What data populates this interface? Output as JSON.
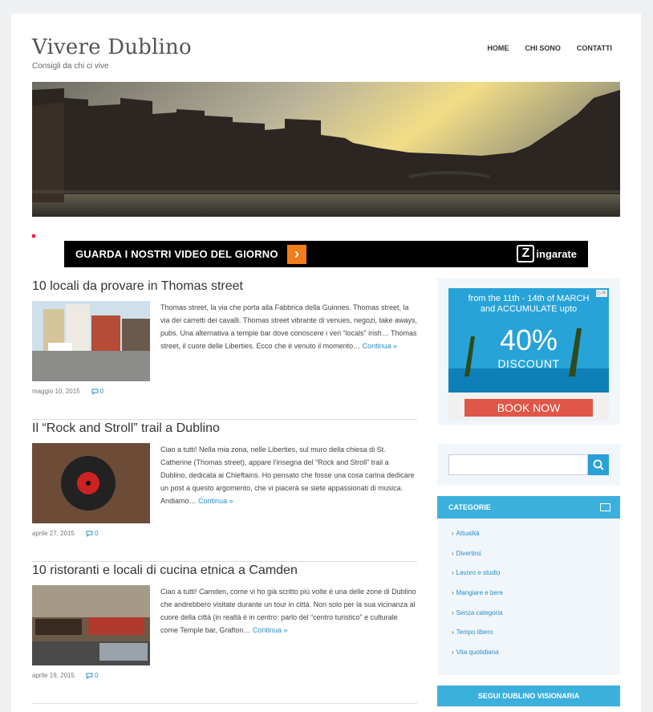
{
  "site": {
    "title": "Vivere Dublino",
    "description": "Consigli da chi ci vive"
  },
  "nav": {
    "items": [
      "HOME",
      "CHI SONO",
      "CONTATTI"
    ]
  },
  "banner": {
    "text": "GUARDA I NOSTRI VIDEO DEL GIORNO",
    "arrow": "›",
    "logo_letter": "Z",
    "logo_text": "ingarate"
  },
  "posts": [
    {
      "title": "10 locali da provare in Thomas street",
      "excerpt": "Thomas street, la via che porta alla Fabbrica della Guinnes. Thomas street, la via dei carretti dei cavalli. Thomas street vibrante di venues, negozi, take aways, pubs. Una alternativa a temple bar dove conoscere i veri “locals” irish… Thomas street, il cuore delle Liberties. Ecco che è venuto il momento…",
      "more": "Continua »",
      "date": "maggio 10, 2015",
      "comments": "0"
    },
    {
      "title": "Il “Rock and Stroll” trail a Dublino",
      "excerpt": "Ciao a tutti! Nella mia zona, nelle Liberties, sul muro della chiesa di St. Catherine (Thomas street), appare l’insegna del “Rock and Stroll” trail a Dublino, dedicata ai Chieftains. Ho pensato che fosse una cosa carina dedicare un post a questo argomento, che vi piacerà se siete appassionati di musica. Andiamo…",
      "more": "Continua »",
      "date": "aprile 27, 2015",
      "comments": "0"
    },
    {
      "title": "10 ristoranti e locali di cucina etnica a Camden",
      "excerpt": "Ciao a tutti! Camden, come vi ho già scritto più volte è una delle zone di Dublino che andrebbero visitate durante un tour in città. Non solo per la sua vicinanza al cuore della città (in realtà è in centro: parlo del “centro turistico” e culturale come Temple bar, Grafton…",
      "more": "Continua »",
      "date": "aprile 19, 2015",
      "comments": "0"
    }
  ],
  "ad": {
    "line1": "from the 11th - 14th of MARCH",
    "line2": "and ACCUMULATE upto",
    "percent": "40%",
    "discount": "DISCOUNT",
    "button": "BOOK NOW",
    "close": "▷✕"
  },
  "search": {
    "placeholder": ""
  },
  "categories": {
    "title": "CATEGORIE",
    "items": [
      "Attualità",
      "Divertirsi",
      "Lavoro e studio",
      "Mangiare e bere",
      "Senza categoria",
      "Tempo libero",
      "Vita quotidiana"
    ]
  },
  "follow": {
    "title": "SEGUI DUBLINO VISIONARIA"
  },
  "colors": {
    "accent": "#3bb0dd",
    "link": "#2a8fc7",
    "banner_orange": "#f07c1b",
    "ad_button": "#e05648"
  }
}
